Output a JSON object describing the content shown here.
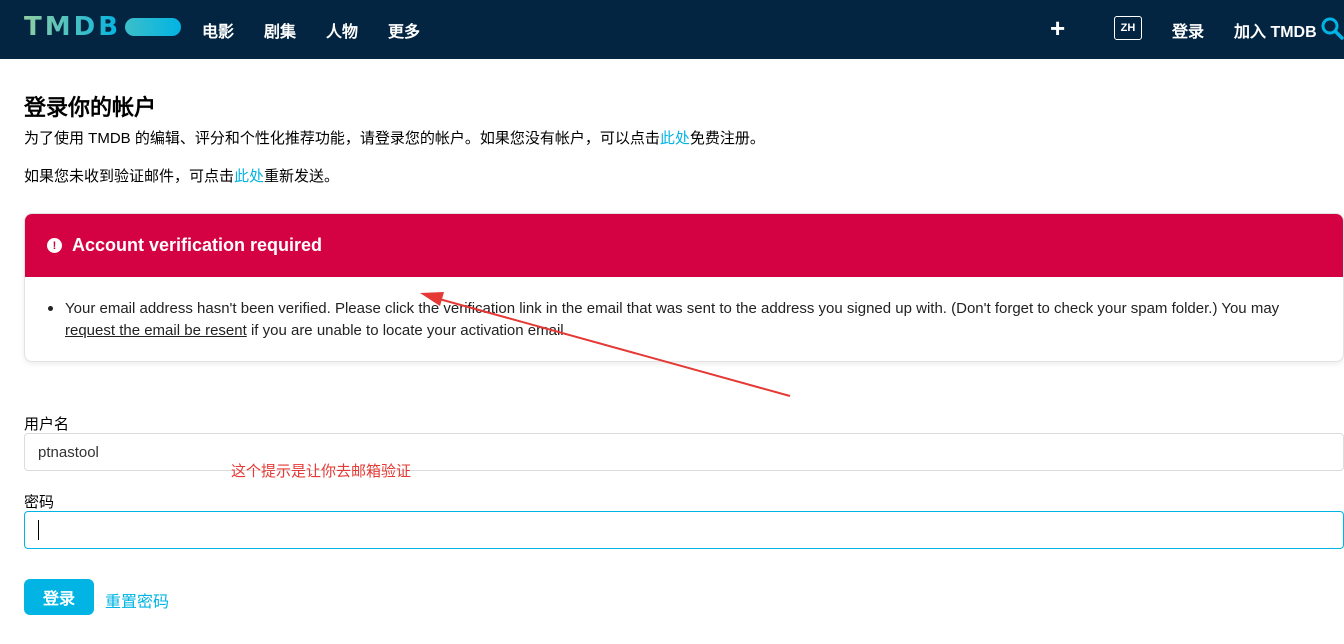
{
  "header": {
    "logo": "TMDB",
    "nav": [
      "电影",
      "剧集",
      "人物",
      "更多"
    ],
    "add_icon": "plus-icon",
    "language": "ZH",
    "login": "登录",
    "join": "加入 TMDB",
    "search_icon": "search-icon",
    "colors": {
      "background": "#032541",
      "accent": "#01b4e4"
    }
  },
  "intro": {
    "title": "登录你的帐户",
    "line1_before": "为了使用 TMDB 的编辑、评分和个性化推荐功能，请登录您的帐户。如果您没有帐户，可以点击",
    "line1_link": "此处",
    "line1_after": "免费注册。",
    "line2_before": "如果您未收到验证邮件，可点击",
    "line2_link": "此处",
    "line2_after": "重新发送。"
  },
  "alert": {
    "icon": "exclamation-icon",
    "title": "Account verification required",
    "body_before": "Your email address hasn't been verified. Please click the verification link in the email that was sent to the address you signed up with. (Don't forget to check your spam folder.) You may",
    "body_link": "request the email be resent",
    "body_after": "if you are unable to locate your activation email.",
    "color": "#d40242"
  },
  "form": {
    "username_label": "用户名",
    "username_value": "ptnastool",
    "password_label": "密码",
    "password_value": "",
    "submit": "登录",
    "reset": "重置密码"
  },
  "annotation": {
    "text": "这个提示是让你去邮箱验证",
    "color": "#e53935"
  }
}
